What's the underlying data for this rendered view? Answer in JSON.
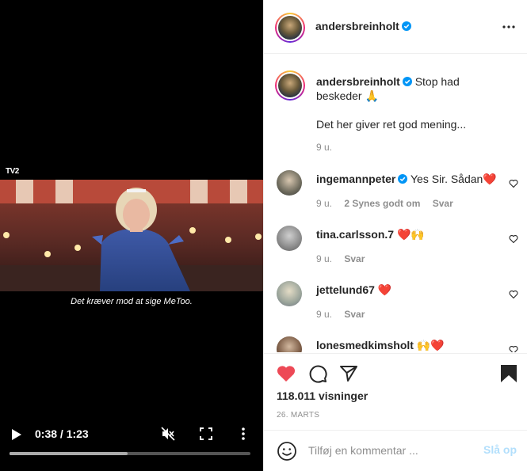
{
  "video": {
    "channel_logo": "TV2",
    "subtitle": "Det kræver mod at sige MeToo.",
    "time_display": "0:38 / 1:23",
    "progress_fraction": 0.46,
    "buffer_fraction": 0.49
  },
  "post": {
    "author": "andersbreinholt",
    "author_verified": true,
    "caption_text": "Stop had beskeder 🙏",
    "caption_body": "Det her giver ret god mening...",
    "caption_time": "9 u.",
    "comments": [
      {
        "user": "ingemannpeter",
        "verified": true,
        "text": "Yes Sir. Sådan❤️",
        "time": "9 u.",
        "likes": "2 Synes godt om",
        "reply": "Svar"
      },
      {
        "user": "tina.carlsson.7",
        "verified": false,
        "text": "❤️🙌",
        "time": "9 u.",
        "likes": "",
        "reply": "Svar"
      },
      {
        "user": "jettelund67",
        "verified": false,
        "text": "❤️",
        "time": "9 u.",
        "likes": "",
        "reply": "Svar"
      },
      {
        "user": "lonesmedkimsholt",
        "verified": false,
        "text": "🙌❤️",
        "time": "",
        "likes": "",
        "reply": ""
      }
    ],
    "views": "118.011 visninger",
    "date": "26. MARTS"
  },
  "comment_box": {
    "placeholder": "Tilføj en kommentar ...",
    "post_label": "Slå op"
  },
  "icons": [
    "play-icon",
    "mute-icon",
    "fullscreen-icon",
    "more-vertical-icon",
    "more-horizontal-icon",
    "verified-icon",
    "heart-icon",
    "comment-icon",
    "share-icon",
    "bookmark-icon",
    "emoji-icon"
  ],
  "colors": {
    "like": "#ed4956",
    "verified": "#0095f6",
    "post_disabled": "#b2dffc"
  }
}
